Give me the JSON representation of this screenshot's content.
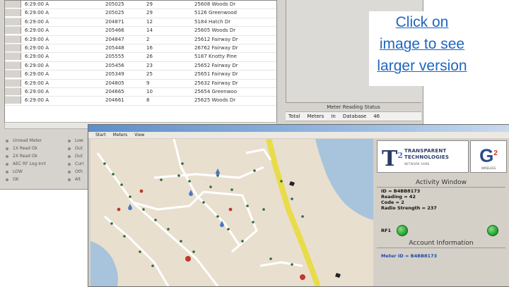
{
  "grid": {
    "rows": [
      {
        "time": "6:29:00 A",
        "meter": "205025",
        "reading": "29",
        "address": "25608 Woods Dr"
      },
      {
        "time": "6:29:00 A",
        "meter": "205025",
        "reading": "29",
        "address": "5126 Greenwood"
      },
      {
        "time": "6:29:00 A",
        "meter": "204871",
        "reading": "12",
        "address": "5184 Hatch Dr"
      },
      {
        "time": "6:29:00 A",
        "meter": "205466",
        "reading": "14",
        "address": "25605 Woods Dr"
      },
      {
        "time": "6:29:00 A",
        "meter": "204847",
        "reading": "2",
        "address": "25612 Fairway Dr"
      },
      {
        "time": "6:29:00 A",
        "meter": "205448",
        "reading": "16",
        "address": "26762 Fairway Dr"
      },
      {
        "time": "6:29:00 A",
        "meter": "205555",
        "reading": "26",
        "address": "5187 Knotty Pine"
      },
      {
        "time": "6:29:00 A",
        "meter": "205456",
        "reading": "23",
        "address": "25652 Fairway Dr"
      },
      {
        "time": "6:29:00 A",
        "meter": "205349",
        "reading": "25",
        "address": "25651 Fairway Dr"
      },
      {
        "time": "6:29:00 A",
        "meter": "204805",
        "reading": "9",
        "address": "25632 Fairway Dr"
      },
      {
        "time": "6:29:00 A",
        "meter": "204665",
        "reading": "10",
        "address": "25654 Greenwoo"
      },
      {
        "time": "6:29:00 A",
        "meter": "204661",
        "reading": "8",
        "address": "25625 Woods Dr"
      }
    ]
  },
  "status": {
    "title": "Meter Reading Status",
    "items": [
      "Total",
      "Meters",
      "In",
      "Database",
      "46"
    ]
  },
  "legend": {
    "left": [
      "Unread Meter",
      "1X Read Ok",
      "2X Read Ok",
      "AEC RF Log-Inrt",
      "LOW",
      "OK"
    ],
    "right": [
      "Low",
      "Out",
      "Out",
      "Curr",
      "Oth",
      "Alt"
    ]
  },
  "caption": {
    "line1": "Click on",
    "line2": "image to see",
    "line3": "larger version"
  },
  "front": {
    "menu": [
      "Start",
      "Meters",
      "View"
    ]
  },
  "logos": {
    "tt_line1": "TRANSPARENT",
    "tt_line2": "TECHNOLOGIES",
    "tt_line3": "NETWORK SAME",
    "g_letter": "G",
    "g_sup": "2",
    "g_sub": "WIRELESS"
  },
  "activity": {
    "title": "Activity Window",
    "id": "ID = B4BB8173",
    "reading": "Reading = 42",
    "code": "Code = 2",
    "radio": "Radio Strength = 237",
    "rf_label": "RF1"
  },
  "account": {
    "title": "Account Information",
    "meter_id": "Meter ID = B4BB8173"
  },
  "colors": {
    "accent": "#1f66c0",
    "map_land": "#e9dfcf",
    "map_water": "#a8c4dc",
    "highway": "#e8dc4a",
    "led": "#1f9a2b"
  }
}
